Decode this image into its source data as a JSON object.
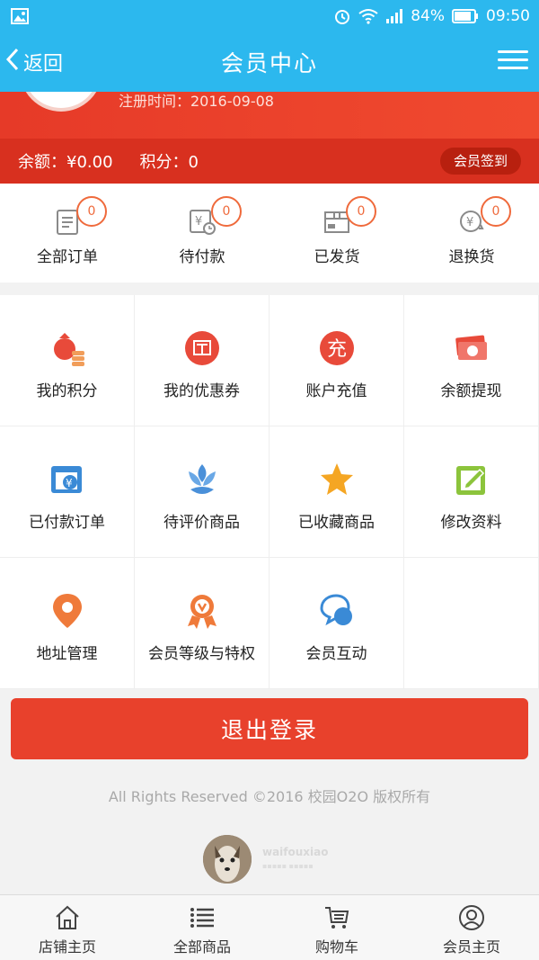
{
  "status_bar": {
    "battery": "84%",
    "time": "09:50"
  },
  "header": {
    "back_label": "返回",
    "title": "会员中心"
  },
  "profile": {
    "register_time": "注册时间：2016-09-08",
    "balance": "余额：¥0.00",
    "points": "积分：0",
    "checkin_label": "会员签到"
  },
  "orders": [
    {
      "label": "全部订单",
      "count": "0",
      "icon": "order-list-icon"
    },
    {
      "label": "待付款",
      "count": "0",
      "icon": "pending-payment-icon"
    },
    {
      "label": "已发货",
      "count": "0",
      "icon": "shipped-box-icon"
    },
    {
      "label": "退换货",
      "count": "0",
      "icon": "return-exchange-icon"
    }
  ],
  "services": [
    {
      "label": "我的积分",
      "icon": "money-bag-icon"
    },
    {
      "label": "我的优惠券",
      "icon": "coupon-icon"
    },
    {
      "label": "账户充值",
      "icon": "recharge-icon"
    },
    {
      "label": "余额提现",
      "icon": "withdraw-cash-icon"
    },
    {
      "label": "已付款订单",
      "icon": "paid-order-icon"
    },
    {
      "label": "待评价商品",
      "icon": "review-flower-icon"
    },
    {
      "label": "已收藏商品",
      "icon": "star-icon"
    },
    {
      "label": "修改资料",
      "icon": "edit-profile-icon"
    },
    {
      "label": "地址管理",
      "icon": "location-pin-icon"
    },
    {
      "label": "会员等级与特权",
      "icon": "medal-icon"
    },
    {
      "label": "会员互动",
      "icon": "chat-bubbles-icon"
    }
  ],
  "logout_label": "退出登录",
  "copyright": "All Rights Reserved ©2016 校园O2O 版权所有",
  "dev_logo": "waifouxiao",
  "nav": [
    {
      "label": "店铺主页",
      "icon": "home-icon"
    },
    {
      "label": "全部商品",
      "icon": "list-icon"
    },
    {
      "label": "购物车",
      "icon": "cart-icon"
    },
    {
      "label": "会员主页",
      "icon": "user-icon"
    }
  ],
  "colors": {
    "header": "#2cb8ee",
    "banner": "#e63a28",
    "badge": "#ef6a3c",
    "logout": "#e8412c"
  }
}
